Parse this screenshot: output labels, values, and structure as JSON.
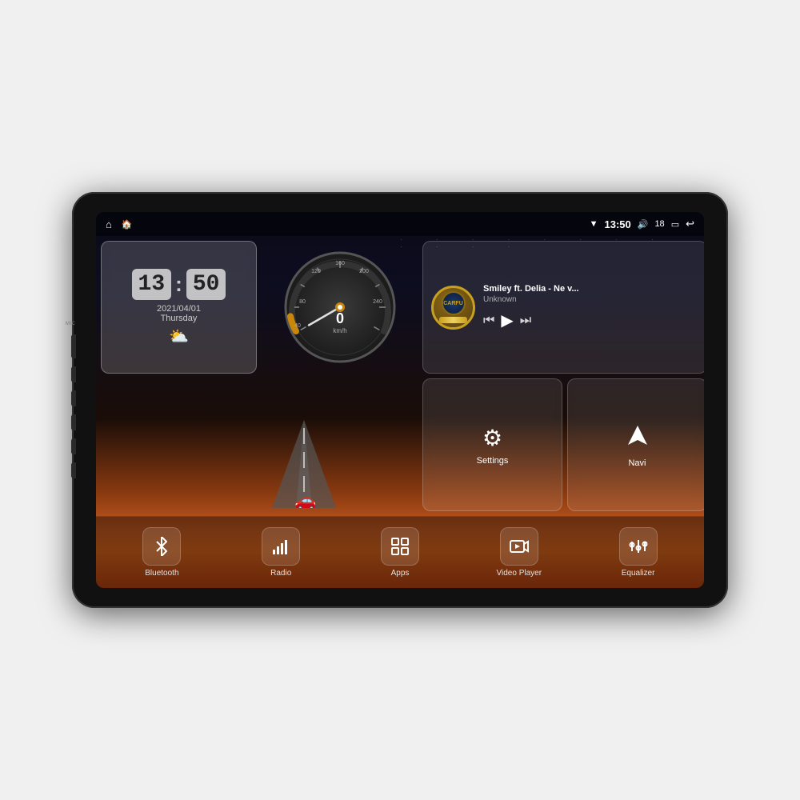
{
  "device": {
    "outer_bg": "#111",
    "screen_bg": "#1a1a2e"
  },
  "status_bar": {
    "mic_label": "MIC",
    "home_icon": "⌂",
    "house_icon": "🏠",
    "wifi_icon": "▼",
    "time": "13:50",
    "volume_icon": "🔊",
    "volume_value": "18",
    "battery_icon": "▭",
    "back_icon": "↩"
  },
  "clock_widget": {
    "hours": "13",
    "minutes": "50",
    "date": "2021/04/01",
    "day": "Thursday",
    "weather_icon": "⛅"
  },
  "music_widget": {
    "title": "Smiley ft. Delia - Ne v...",
    "artist": "Unknown",
    "prev_icon": "⏮",
    "play_icon": "▶",
    "next_icon": "⏭"
  },
  "settings_widget": {
    "icon": "⚙",
    "label": "Settings"
  },
  "navi_widget": {
    "icon": "◬",
    "label": "Navi"
  },
  "speedometer": {
    "speed_value": "0",
    "unit": "km/h"
  },
  "bottom_items": [
    {
      "id": "bluetooth",
      "icon": "⁂",
      "label": "Bluetooth"
    },
    {
      "id": "radio",
      "icon": "📶",
      "label": "Radio"
    },
    {
      "id": "apps",
      "icon": "⊞",
      "label": "Apps"
    },
    {
      "id": "video",
      "icon": "▶",
      "label": "Video Player"
    },
    {
      "id": "equalizer",
      "icon": "⚌",
      "label": "Equalizer"
    }
  ]
}
